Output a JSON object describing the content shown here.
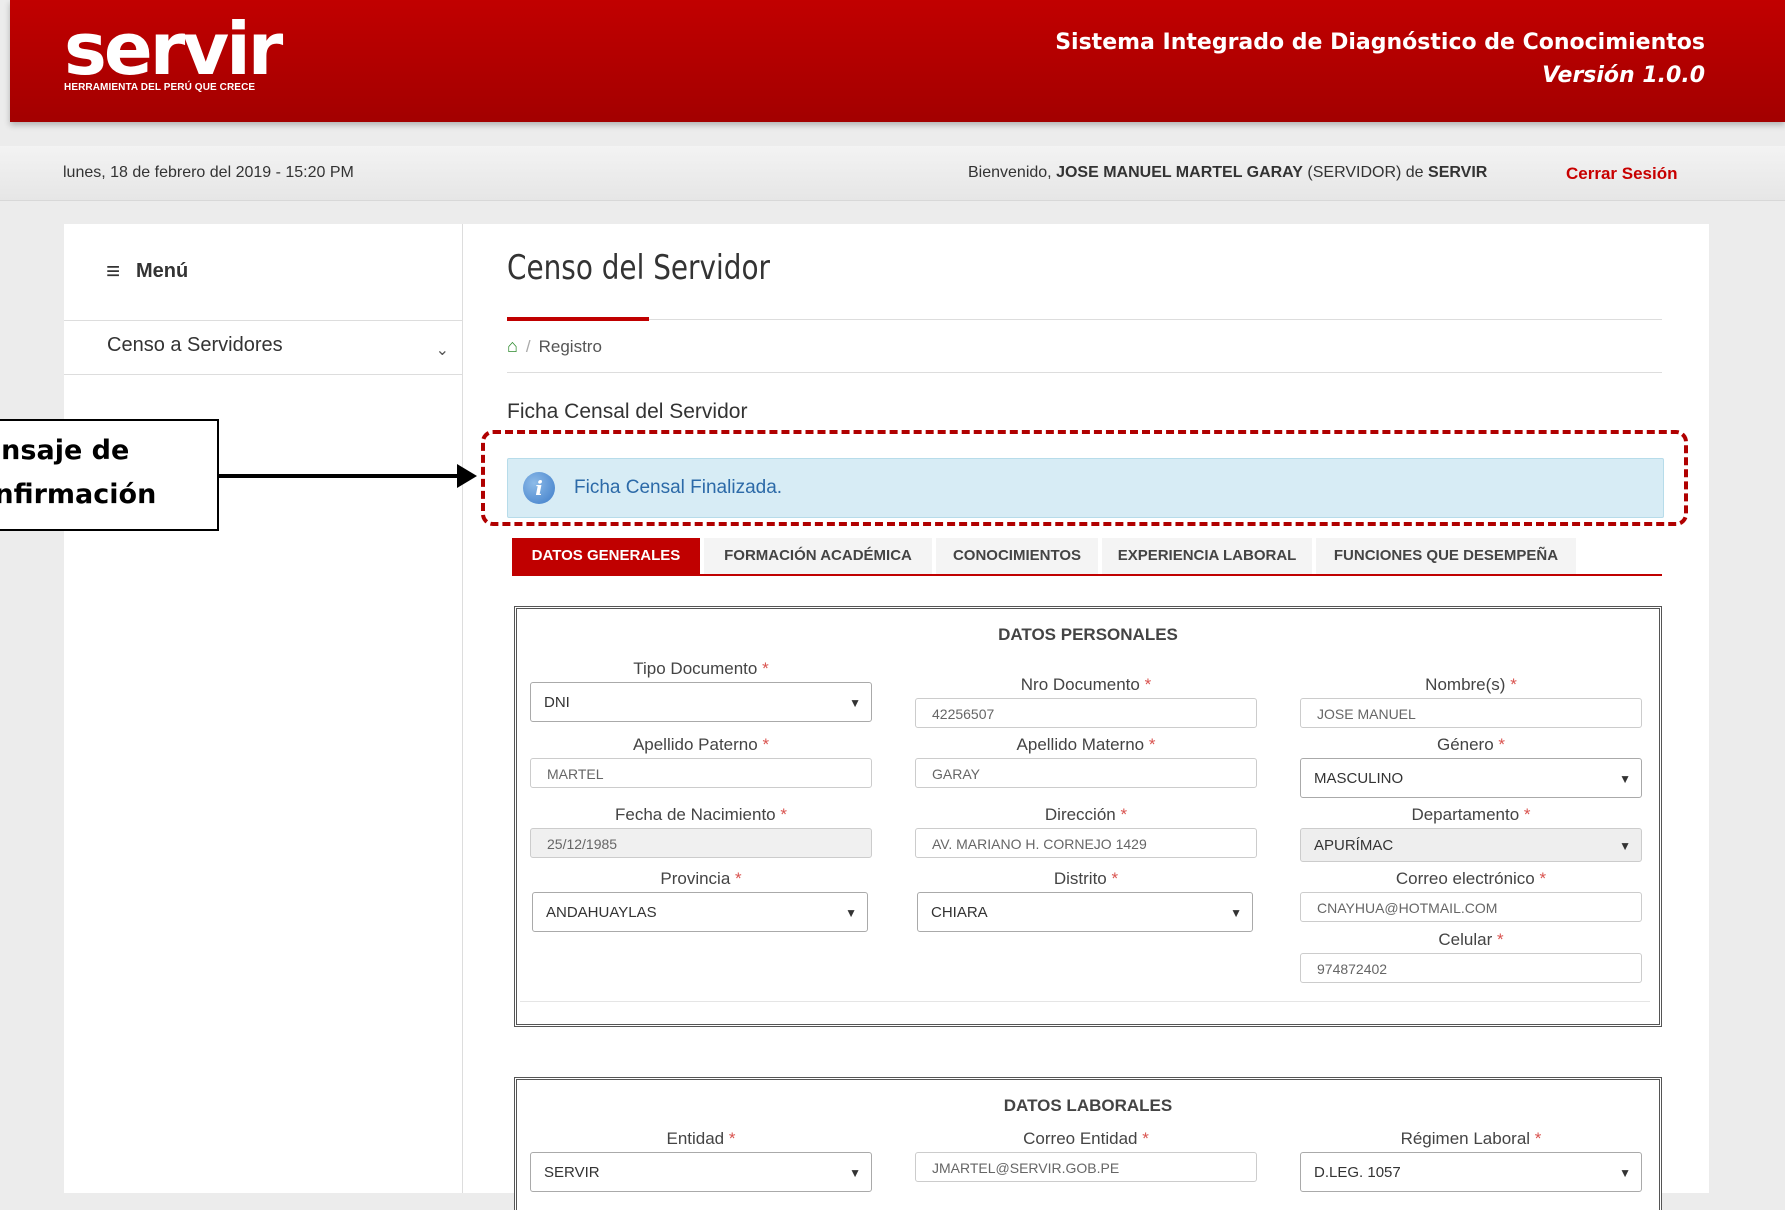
{
  "header": {
    "logo_text": "servir",
    "logo_tagline": "HERRAMIENTA DEL PERÚ QUE CRECE",
    "system_title": "Sistema Integrado de Diagnóstico de Conocimientos",
    "version": "Versión 1.0.0"
  },
  "infobar": {
    "date": "lunes, 18 de febrero del 2019 - 15:20 PM",
    "welcome_prefix": "Bienvenido,",
    "user_name": "JOSE MANUEL MARTEL GARAY",
    "user_role": "(SERVIDOR) de",
    "organization": "SERVIR",
    "logout_label": "Cerrar Sesión"
  },
  "sidebar": {
    "menu_label": "Menú",
    "items": [
      {
        "label": "Censo a Servidores"
      }
    ]
  },
  "page": {
    "title": "Censo del Servidor",
    "breadcrumb_current": "Registro",
    "section_title": "Ficha Censal del Servidor"
  },
  "alert": {
    "message": "Ficha Censal Finalizada."
  },
  "tabs": [
    {
      "label": "DATOS GENERALES",
      "active": true
    },
    {
      "label": "FORMACIÓN ACADÉMICA"
    },
    {
      "label": "CONOCIMIENTOS"
    },
    {
      "label": "EXPERIENCIA LABORAL"
    },
    {
      "label": "FUNCIONES QUE DESEMPEÑA"
    }
  ],
  "datos_personales": {
    "title": "DATOS PERSONALES",
    "tipo_documento": {
      "label": "Tipo Documento",
      "value": "DNI"
    },
    "nro_documento": {
      "label": "Nro Documento",
      "value": "42256507"
    },
    "nombres": {
      "label": "Nombre(s)",
      "value": "JOSE MANUEL"
    },
    "apellido_paterno": {
      "label": "Apellido Paterno",
      "value": "MARTEL"
    },
    "apellido_materno": {
      "label": "Apellido Materno",
      "value": "GARAY"
    },
    "genero": {
      "label": "Género",
      "value": "MASCULINO"
    },
    "fecha_nacimiento": {
      "label": "Fecha de Nacimiento",
      "value": "25/12/1985"
    },
    "direccion": {
      "label": "Dirección",
      "value": "AV. MARIANO H. CORNEJO 1429"
    },
    "departamento": {
      "label": "Departamento",
      "value": "APURÍMAC"
    },
    "provincia": {
      "label": "Provincia",
      "value": "ANDAHUAYLAS"
    },
    "distrito": {
      "label": "Distrito",
      "value": "CHIARA"
    },
    "correo": {
      "label": "Correo electrónico",
      "value": "CNAYHUA@HOTMAIL.COM"
    },
    "celular": {
      "label": "Celular",
      "value": "974872402"
    }
  },
  "datos_laborales": {
    "title": "DATOS LABORALES",
    "entidad": {
      "label": "Entidad",
      "value": "SERVIR"
    },
    "correo_entidad": {
      "label": "Correo Entidad",
      "value": "JMARTEL@SERVIR.GOB.PE"
    },
    "regimen": {
      "label": "Régimen Laboral",
      "value": "D.LEG. 1057"
    }
  },
  "required_mark": "*",
  "annotation": {
    "line1": "Mensaje de",
    "line2": "Confirmación"
  }
}
